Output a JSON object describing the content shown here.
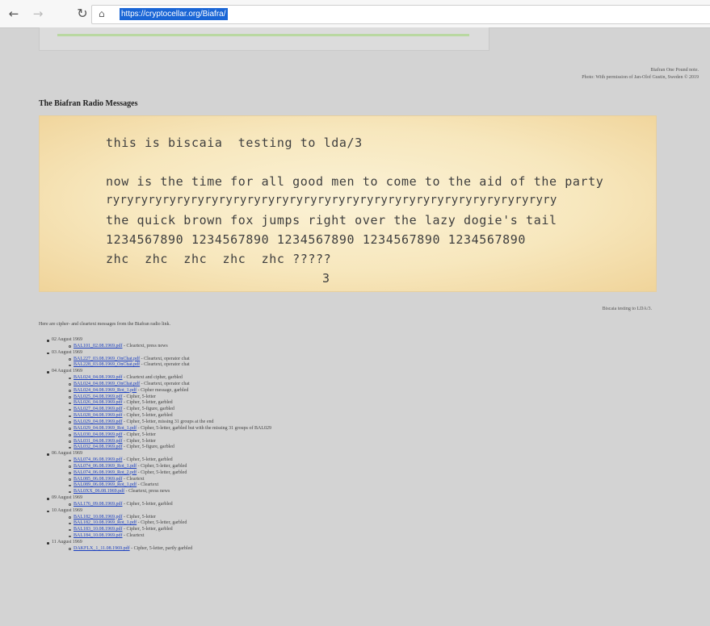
{
  "browser": {
    "back_icon": "←",
    "forward_icon": "→",
    "reload_icon": "↻",
    "home_icon": "⌂",
    "url": "https://cryptocellar.org/Biafra/"
  },
  "page": {
    "banner_caption": [
      "Biafran One Pound note.",
      "Photo: With permission of Jan-Olof Gustin, Sweden © 2019"
    ],
    "section_title": "The Biafran Radio Messages",
    "teletype_lines": [
      "this is biscaia  testing to lda/3",
      "now is the time for all good men to come to the aid of the party",
      "ryryryryryryryryryryryryryryryryryryryryryryryryryryryryryryryry",
      "the quick brown fox jumps right over the lazy dogie's tail",
      "1234567890 1234567890 1234567890 1234567890 1234567890",
      "zhc  zhc  zhc  zhc  zhc ?????",
      "3"
    ],
    "teletype_caption": "Biscaia testing to LDA/3.",
    "intro": "Here are cipher- and cleartext messages from the Biafran radio link."
  },
  "messages": [
    {
      "date": "02 August 1969",
      "files": [
        {
          "link": "BAL101_02.08.1969.pdf",
          "desc": " - Cleartext, press news"
        }
      ]
    },
    {
      "date": "03 August 1969",
      "files": [
        {
          "link": "BAL227_03.08.1969_OnChat.pdf",
          "desc": " - Cleartext, operator chat"
        },
        {
          "link": "BAL228_03.08.1969_OnChat.pdf",
          "desc": " - Cleartext, operator chat"
        }
      ]
    },
    {
      "date": "04 August 1969",
      "files": [
        {
          "link": "BAL024_04.08.1969.pdf",
          "desc": " - Cleartext and cipher, garbled"
        },
        {
          "link": "BAL024_04.08.1969_OnChat.pdf",
          "desc": " - Cleartext, operator chat"
        },
        {
          "link": "BAL024_04.08.1969_Rot_1.pdf",
          "desc": " - Cipher message, garbled"
        },
        {
          "link": "BAL025_04.08.1969.pdf",
          "desc": " - Cipher, 5-letter"
        },
        {
          "link": "BAL026_04.08.1969.pdf",
          "desc": " - Cipher, 5-letter, garbled"
        },
        {
          "link": "BAL027_04.08.1969.pdf",
          "desc": " - Cipher, 5-figure, garbled"
        },
        {
          "link": "BAL028_04.08.1969.pdf",
          "desc": " - Cipher, 5-letter, garbled"
        },
        {
          "link": "BAL029_04.08.1969.pdf",
          "desc": " - Cipher, 5-letter, missing 31 groups at the end"
        },
        {
          "link": "BAL029_04.08.1969_Rot_1.pdf",
          "desc": " - Cipher, 5-letter, garbled but with the missing 31 groups of BAL029"
        },
        {
          "link": "BAL030_04.08.1969.pdf",
          "desc": " - Cipher, 5-letter"
        },
        {
          "link": "BAL031_04.08.1969.pdf",
          "desc": " - Cipher, 5-letter"
        },
        {
          "link": "BAL032_04.08.1969.pdf",
          "desc": " - Cipher, 5-figure, garbled"
        }
      ]
    },
    {
      "date": "06 August 1969",
      "files": [
        {
          "link": "BAL074_06.08.1969.pdf",
          "desc": " - Cipher, 5-letter, garbled"
        },
        {
          "link": "BAL074_06.08.1969_Rot_1.pdf",
          "desc": " - Cipher, 5-letter, garbled"
        },
        {
          "link": "BAL074_06.08.1969_Rot_2.pdf",
          "desc": " - Cipher, 5-letter, garbled"
        },
        {
          "link": "BAL085_06.08.1969.pdf",
          "desc": " - Cleartext"
        },
        {
          "link": "BAL089_06.08.1969_Rot_1.pdf",
          "desc": " - Cleartext"
        },
        {
          "link": "BAL0XX_06.08.1969.pdf",
          "desc": " - Cleartext, press news"
        }
      ]
    },
    {
      "date": "09 August 1969",
      "files": [
        {
          "link": "BAL176_09.08.1969.pdf",
          "desc": " - Cipher, 5-letter, garbled"
        }
      ]
    },
    {
      "date": "10 August 1969",
      "files": [
        {
          "link": "BAL182_10.08.1969.pdf",
          "desc": " - Cipher, 5-letter"
        },
        {
          "link": "BAL182_10.08.1969_Rot_1.pdf",
          "desc": " - Cipher, 5-letter, garbled"
        },
        {
          "link": "BAL183_10.08.1969.pdf",
          "desc": " - Cipher, 5-letter, garbled"
        },
        {
          "link": "BAL184_10.08.1969.pdf",
          "desc": " - Cleartext"
        }
      ]
    },
    {
      "date": "11 August 1969",
      "files": [
        {
          "link": "DAKFLX_1_11.08.1969.pdf",
          "desc": " - Cipher, 5-letter, partly garbled"
        }
      ]
    }
  ]
}
